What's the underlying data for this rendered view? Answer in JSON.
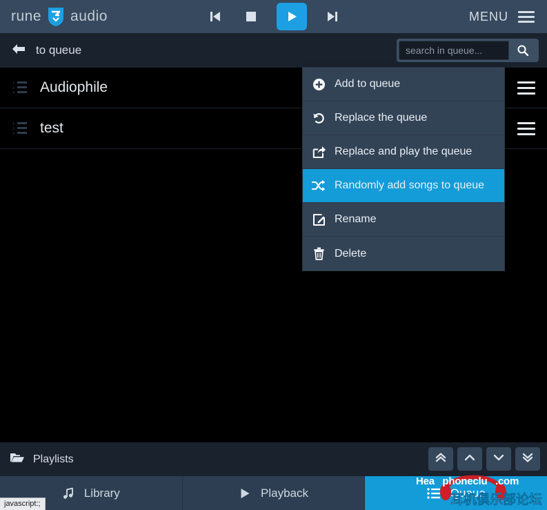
{
  "app": {
    "brand_left": "rune",
    "brand_right": "audio",
    "brand_icon": "runeaudio-shield-icon",
    "accent_color": "#139cd8",
    "topbar_color": "#37495e",
    "subheader_color": "#1a222e",
    "list_bg_color": "#000000"
  },
  "transport": {
    "previous_label": "previous-track",
    "stop_label": "stop",
    "play_label": "play",
    "next_label": "next-track",
    "play_active": true
  },
  "menu": {
    "label": "MENU",
    "icon": "hamburger-icon"
  },
  "subheader": {
    "back_icon": "arrow-left-icon",
    "title": "to queue"
  },
  "search": {
    "value": "",
    "placeholder": "search in queue...",
    "button_icon": "search-icon"
  },
  "playlists": [
    {
      "icon": "ordered-list-icon",
      "title": "Audiophile",
      "handle_icon": "hamburger-icon"
    },
    {
      "icon": "ordered-list-icon",
      "title": "test",
      "handle_icon": "hamburger-icon"
    }
  ],
  "context_menu": {
    "items": [
      {
        "icon": "plus-circle-icon",
        "label": "Add to queue",
        "active": false
      },
      {
        "icon": "undo-icon",
        "label": "Replace the queue",
        "active": false
      },
      {
        "icon": "share-square-icon",
        "label": "Replace and play the queue",
        "active": false
      },
      {
        "icon": "shuffle-icon",
        "label": "Randomly add songs to queue",
        "active": true
      },
      {
        "icon": "pencil-square-icon",
        "label": "Rename",
        "active": false
      },
      {
        "icon": "trash-icon",
        "label": "Delete",
        "active": false
      }
    ]
  },
  "footer": {
    "folder_icon": "folder-open-icon",
    "label": "Playlists",
    "scroll_buttons": [
      {
        "icon": "angle-double-up-icon",
        "name": "scroll-top"
      },
      {
        "icon": "angle-up-icon",
        "name": "scroll-up"
      },
      {
        "icon": "angle-down-icon",
        "name": "scroll-down"
      },
      {
        "icon": "angle-double-down-icon",
        "name": "scroll-bottom"
      }
    ]
  },
  "tabs": [
    {
      "icon": "music-note-icon",
      "label": "Library",
      "active": false
    },
    {
      "icon": "play-icon",
      "label": "Playback",
      "active": false
    },
    {
      "icon": "list-icon",
      "label": "Queue",
      "active": true
    }
  ],
  "statusbar": {
    "text": "javascript:;"
  },
  "watermark": {
    "line1_a": "Hea",
    "line1_b": "phoneclu",
    "line1_c": ".com",
    "line2": "耳机俱乐部论坛"
  }
}
